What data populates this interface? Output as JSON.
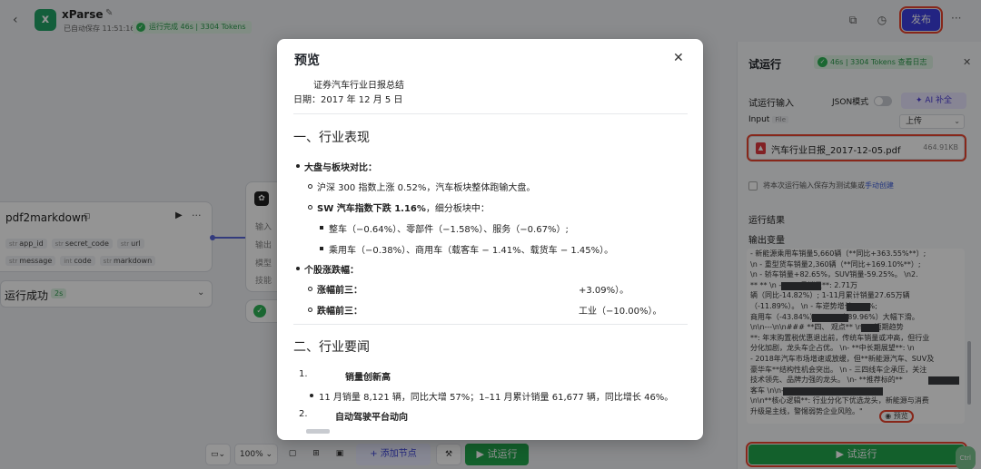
{
  "topbar": {
    "app_name": "xParse",
    "autosave": "已自动保存 11:51:16",
    "run_status": "运行完成 46s | 3304 Tokens",
    "publish_label": "发布",
    "colors": {
      "brand": "#3d3ee0",
      "success": "#21a54c",
      "highlight": "#e8442e"
    }
  },
  "canvas": {
    "node1": {
      "title": "pdf2markdown",
      "outputs": [
        {
          "type": "str",
          "name": "app_id"
        },
        {
          "type": "str",
          "name": "secret_code"
        },
        {
          "type": "str",
          "name": "url"
        },
        {
          "type": "str",
          "name": "message"
        },
        {
          "type": "int",
          "name": "code"
        },
        {
          "type": "str",
          "name": "markdown"
        }
      ],
      "run_status": "运行成功",
      "run_time": "2s"
    },
    "node2": {
      "rows": [
        "输入",
        "输出",
        "模型",
        "技能"
      ]
    }
  },
  "bottombar": {
    "zoom": "100%",
    "add_node": "+ 添加节点",
    "run": "▶ 试运行"
  },
  "panel": {
    "title": "试运行",
    "badge": "46s | 3304 Tokens  查看日志",
    "input_section": "试运行输入",
    "json_mode": "JSON模式",
    "ai_fill": "✦ AI 补全",
    "input_label": "Input",
    "input_type": "File",
    "upload_value": "上传",
    "file_name": "汽车行业日报_2017-12-05.pdf",
    "file_size": "464.91KB",
    "save_text": "将本次运行输入保存为测试集或",
    "save_link": "手动创建",
    "result_section": "运行结果",
    "output_var": "输出变量",
    "output_lines": [
      "- 新能源乘用车销量5,660辆（**同比+363.55%**）;",
      "\\n    - 重型货车销量2,360辆（**同比+169.10%**）;",
      "\\n    - 轿车销量+82.65%，SUV销量-59.25%。  \\n2.",
      "**                  ** \\n  - **11月销量**: 2.71万",
      "辆（同比-14.82%）; 1-11月累计销量27.65万辆",
      "（-11.89%）。 \\n    -           车逆势增长6.60%;",
      "商用车（-43.84%）、            SUV（-89.96%）大幅下滑。",
      "\\n\\n---\\n\\n### **四、           观点**  \\n- **短期趋势",
      "**: 年末购置税优惠退出前，传统车销量或冲高，但行业",
      "分化加剧，龙头车企占优。 \\n- **中长期展望**:  \\n",
      "- 2018年汽车市场增速或放缓，但**新能源汽车、SUV及",
      "豪华车**结构性机会突出。 \\n - 三四线车企承压，关注",
      "技术领先、品牌力强的龙头。 \\n- **推荐标的**",
      "客车                                          \\n\\n---",
      "\\n\\n**核心逻辑**: 行业分化下优选龙头，新能源与消费",
      "升级是主线，警惕弱势企业风险。\""
    ],
    "preview_link": "◉ 预览",
    "run_button": "▶ 试运行",
    "shortcut": "Ctrl"
  },
  "modal": {
    "title": "预览",
    "doc_title": "证券汽车行业日报总结",
    "doc_date": "日期：2017 年 12 月 5 日",
    "section1": "一、行业表现",
    "s1_b1": "大盘与板块对比：",
    "s1_b1_sub1": "沪深 300 指数上涨 0.52%，汽车板块整体跑输大盘。",
    "s1_b1_sub2_bold": "SW 汽车指数下跌 1.16%",
    "s1_b1_sub2_rest": "，细分板块中：",
    "s1_b1_sub2_a": "整车（−0.64%）、零部件（−1.58%）、服务（−0.67%）;",
    "s1_b1_sub2_b": "乘用车（−0.38%）、商用车（载客车 − 1.41%、载货车 − 1.45%）。",
    "s1_b2": "个股涨跌幅：",
    "s1_b2_up_label": "涨幅前三：",
    "s1_b2_up_value": "+3.09%）。",
    "s1_b2_down_label": "跌幅前三：",
    "s1_b2_down_value": "工业（−10.00%）。",
    "section2": "二、行业要闻",
    "news1_num": "1.",
    "news1_title": "销量创新高",
    "news1_detail": "11 月销量 8,121 辆，同比大增 57%；1–11 月累计销量 61,677 辆，同比增长 46%。",
    "news2_num": "2.",
    "news2_title": "自动驾驶平台动向"
  }
}
